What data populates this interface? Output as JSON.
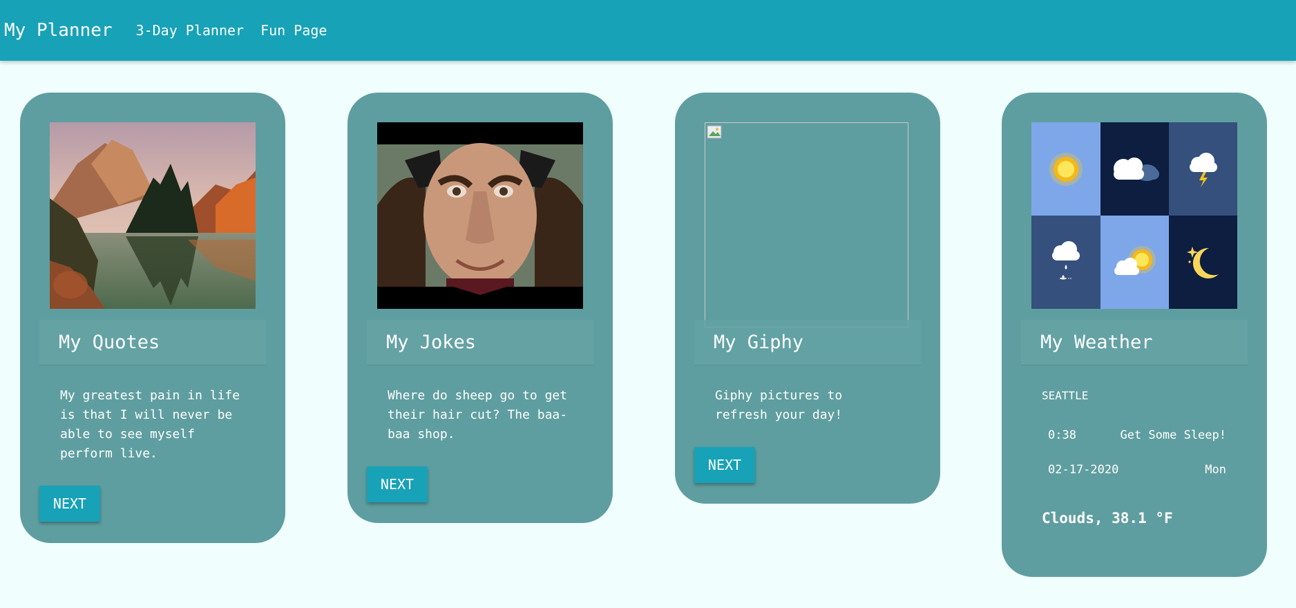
{
  "nav": {
    "brand": "My Planner",
    "links": [
      "3-Day Planner",
      "Fun Page"
    ]
  },
  "cards": {
    "quotes": {
      "title": "My Quotes",
      "text": "My greatest pain in life is that I will never be able to see myself perform live.",
      "button": "NEXT"
    },
    "jokes": {
      "title": "My Jokes",
      "text": "Where do sheep go to get their hair cut? The baa-baa shop.",
      "button": "NEXT"
    },
    "giphy": {
      "title": "My Giphy",
      "text": "Giphy pictures to refresh your day!",
      "button": "NEXT"
    },
    "weather": {
      "title": "My Weather",
      "city": "SEATTLE",
      "time": "0:38",
      "message": "Get Some Sleep!",
      "date": "02-17-2020",
      "day": "Mon",
      "conditions": "Clouds, 38.1 °F",
      "icons": [
        "sun-icon",
        "cloudy-night-icon",
        "thunderstorm-icon",
        "rain-cloud-icon",
        "partly-sunny-icon",
        "moon-stars-icon"
      ]
    }
  },
  "colors": {
    "navbar": "#17a2b8",
    "card": "#5f9ea0",
    "page_background": "#f0fffe"
  }
}
